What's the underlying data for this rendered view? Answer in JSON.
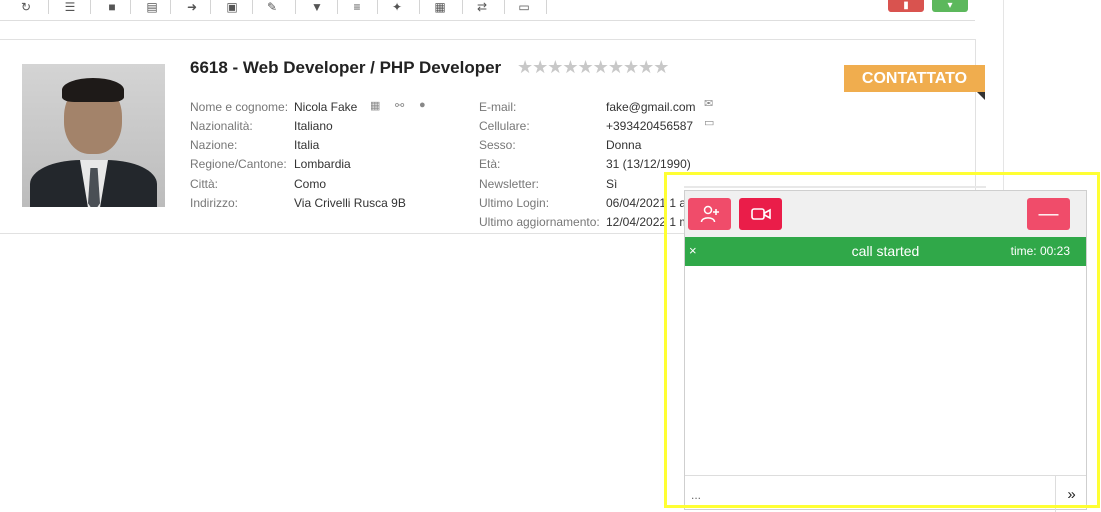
{
  "toolbar": {
    "icons": [
      "refresh-icon",
      "list-icon",
      "video-icon",
      "clipboard-icon",
      "share-icon",
      "copy-icon",
      "wrench-icon",
      "download-icon",
      "menu-icon",
      "star-icon",
      "id-card-icon",
      "transfer-icon",
      "print-icon"
    ],
    "danger_icon": "trash-icon",
    "success_icon": "check-icon"
  },
  "candidate": {
    "title": "6618 - Web Developer / PHP Developer",
    "stars": "★★★★★★★★★★",
    "status": "CONTATTATO",
    "left_fields": [
      {
        "label": "Nome e cognome:",
        "value": "Nicola Fake"
      },
      {
        "label": "Nazionalità:",
        "value": "Italiano"
      },
      {
        "label": "Nazione:",
        "value": "Italia"
      },
      {
        "label": "Regione/Cantone:",
        "value": "Lombardia"
      },
      {
        "label": "Città:",
        "value": "Como"
      },
      {
        "label": "Indirizzo:",
        "value": "Via Crivelli Rusca 9B"
      }
    ],
    "right_fields": [
      {
        "label": "E-mail:",
        "value": "fake@gmail.com"
      },
      {
        "label": "Cellulare:",
        "value": "+393420456587"
      },
      {
        "label": "Sesso:",
        "value": "Donna"
      },
      {
        "label": "Età:",
        "value": "31 (13/12/1990)"
      },
      {
        "label": "Newsletter:",
        "value": "Sì"
      },
      {
        "label": "Ultimo Login:",
        "value": "06/04/2021 1 a"
      },
      {
        "label": "Ultimo aggiornamento:",
        "value": "12/04/2022 1 m"
      }
    ]
  },
  "call": {
    "status_text": "call started",
    "time": "time: 00:23",
    "close_symbol": "×",
    "minimize_symbol": "—",
    "send_symbol": "»",
    "input_placeholder": "..."
  },
  "colors": {
    "status_badge": "#f0ad4e",
    "call_bar": "#30a849",
    "call_buttons": "#f04c6a",
    "highlight": "#ffff33"
  }
}
